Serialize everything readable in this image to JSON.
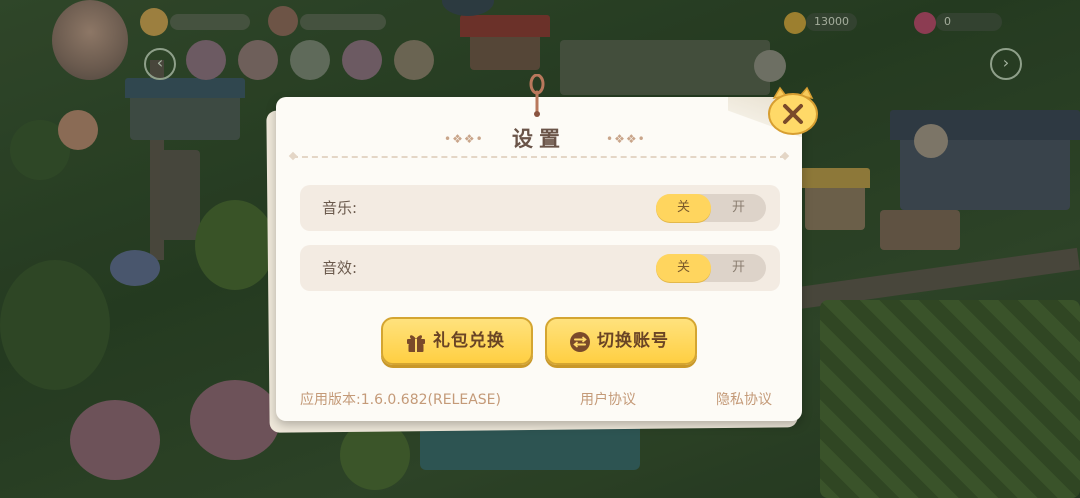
{
  "hud": {
    "coins": "13000",
    "rubies": "0"
  },
  "settings": {
    "title": "设置",
    "music": {
      "label": "音乐:",
      "off_label": "关",
      "on_label": "开",
      "state": "off"
    },
    "sound": {
      "label": "音效:",
      "off_label": "关",
      "on_label": "开",
      "state": "off"
    },
    "gift_button": "礼包兑换",
    "switch_button": "切换账号",
    "version": "应用版本:1.6.0.682(RELEASE)",
    "user_agreement": "用户协议",
    "privacy_policy": "隐私协议"
  },
  "colors": {
    "accent_yellow": "#ffd55e",
    "panel": "#fdfbf6",
    "text_brown": "#6a5448",
    "link_tan": "#c49a78"
  }
}
